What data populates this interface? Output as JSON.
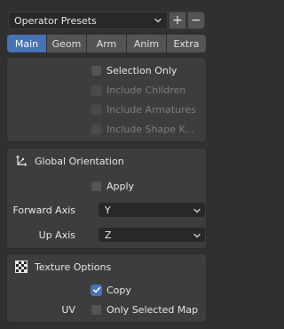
{
  "presets": {
    "value": "Operator Presets",
    "add": "+",
    "remove": "−"
  },
  "tabs": [
    "Main",
    "Geom",
    "Arm",
    "Anim",
    "Extra"
  ],
  "include": {
    "selection_only": "Selection Only",
    "include_children": "Include Children",
    "include_armatures": "Include Armatures",
    "include_shape_keys": "Include Shape K..."
  },
  "orientation": {
    "title": "Global Orientation",
    "apply": "Apply",
    "forward_label": "Forward Axis",
    "forward_value": "Y",
    "up_label": "Up Axis",
    "up_value": "Z"
  },
  "texture": {
    "title": "Texture Options",
    "copy": "Copy",
    "uv_label": "UV",
    "only_selected_map": "Only Selected Map"
  },
  "colors": {
    "accent": "#4772b3",
    "panel": "#3d3d3d",
    "background": "#303030"
  }
}
